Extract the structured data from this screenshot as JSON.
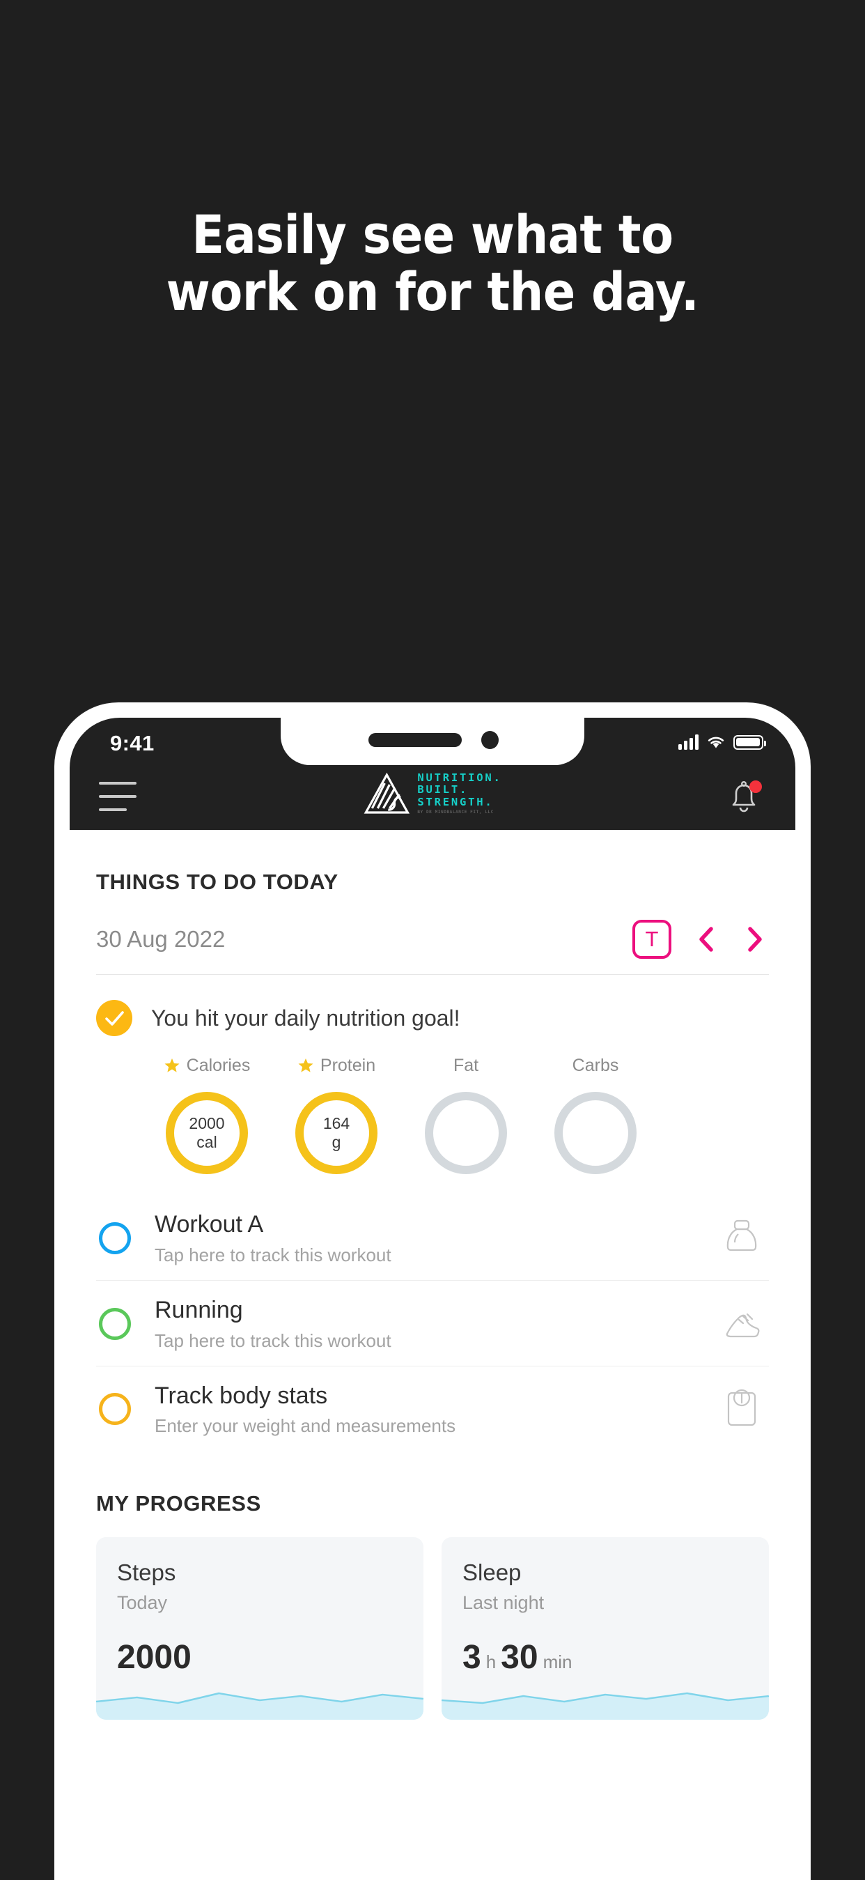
{
  "marketing": {
    "headline_line1": "Easily see what to",
    "headline_line2": "work on for the day."
  },
  "colors": {
    "background": "#1f1f1f",
    "accent_pink": "#ec0f7e",
    "accent_teal": "#16d0c8",
    "accent_yellow": "#f5c21a",
    "accent_blue": "#13a3ef",
    "accent_green": "#5ac85a",
    "accent_orange": "#f6b31b",
    "ring_empty": "#d4d9dd",
    "spark": "#a8e4f0"
  },
  "status_bar": {
    "time": "9:41",
    "signal_icon": "cellular-bars-icon",
    "wifi_icon": "wifi-icon",
    "battery_icon": "battery-icon"
  },
  "navbar": {
    "menu_icon": "hamburger-menu-icon",
    "logo_icon": "nbs-triangle-logo-icon",
    "brand_line1": "NUTRITION.",
    "brand_line2": "BUILT.",
    "brand_line3": "STRENGTH.",
    "brand_tagline": "BY DR MINDBALANCE FIT, LLC",
    "notifications_icon": "bell-icon",
    "notification_badge": ""
  },
  "today": {
    "section_title": "THINGS TO DO TODAY",
    "date": "30 Aug 2022",
    "today_button_label": "T",
    "prev_icon": "chevron-left-icon",
    "next_icon": "chevron-right-icon"
  },
  "nutrition": {
    "check_icon": "check-icon",
    "goal_message": "You hit your daily nutrition goal!",
    "macros": [
      {
        "label": "Calories",
        "starred": true,
        "value": "2000",
        "unit": "cal",
        "complete": true
      },
      {
        "label": "Protein",
        "starred": true,
        "value": "164",
        "unit": "g",
        "complete": true
      },
      {
        "label": "Fat",
        "starred": false,
        "value": "",
        "unit": "",
        "complete": false
      },
      {
        "label": "Carbs",
        "starred": false,
        "value": "",
        "unit": "",
        "complete": false
      }
    ]
  },
  "tasks": [
    {
      "title": "Workout A",
      "subtitle": "Tap here to track this workout",
      "circle_color": "#13a3ef",
      "icon": "kettlebell-icon"
    },
    {
      "title": "Running",
      "subtitle": "Tap here to track this workout",
      "circle_color": "#5ac85a",
      "icon": "running-shoe-icon"
    },
    {
      "title": "Track body stats",
      "subtitle": "Enter your weight and measurements",
      "circle_color": "#f6b31b",
      "icon": "weight-scale-icon"
    }
  ],
  "progress": {
    "section_title": "MY PROGRESS",
    "cards": [
      {
        "title": "Steps",
        "subtitle": "Today",
        "value": "2000",
        "unit": "",
        "value2": "",
        "unit2": ""
      },
      {
        "title": "Sleep",
        "subtitle": "Last night",
        "value": "3",
        "unit": "h",
        "value2": "30",
        "unit2": "min"
      }
    ]
  }
}
